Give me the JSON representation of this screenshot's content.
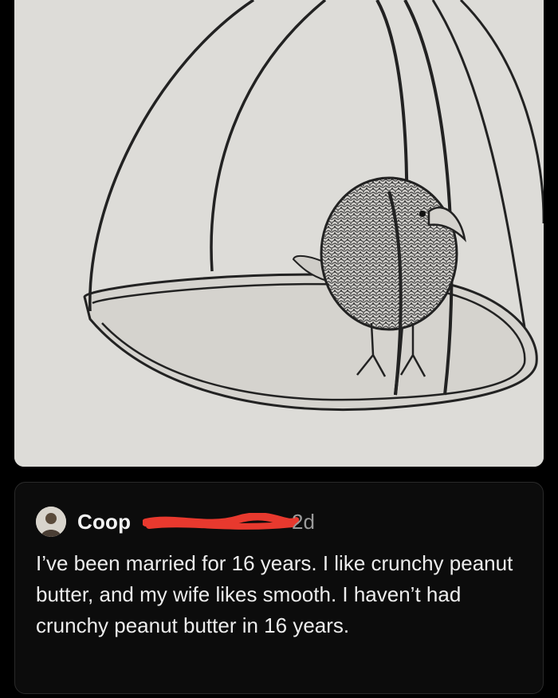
{
  "post": {
    "image": {
      "subject": "pencil-sketch-bird-in-cage"
    }
  },
  "comment": {
    "username": "Coop",
    "timestamp": "2d",
    "text": "I’ve been married for 16 years.  I like crunchy peanut butter, and my wife likes smooth.  I haven’t had crunchy peanut butter in 16 years."
  },
  "colors": {
    "background": "#000000",
    "card": "#0c0c0c",
    "text": "#ededed",
    "muted": "#9a9a9a",
    "redaction": "#e8392e"
  }
}
